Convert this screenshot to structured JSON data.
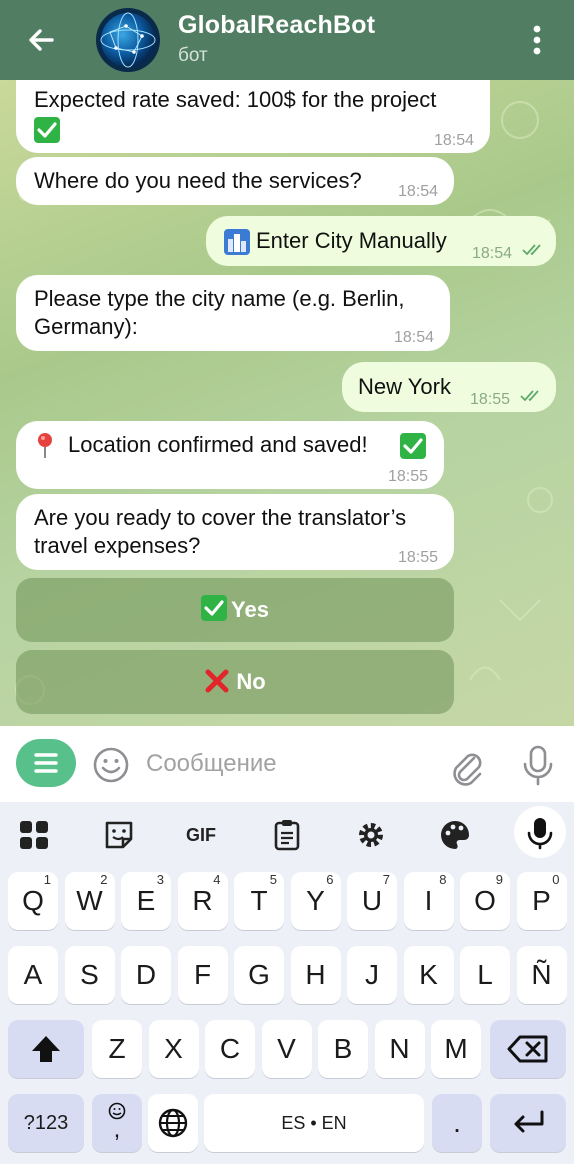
{
  "header": {
    "title": "GlobalReachBot",
    "subtitle": "бот"
  },
  "messages": [
    {
      "text": "Expected rate saved: 100$ for the project",
      "time": "18:54"
    },
    {
      "text": "Where do you need the services?",
      "time": "18:54"
    },
    {
      "text": "Enter City Manually",
      "time": "18:54"
    },
    {
      "line1": "Please type the city name (e.g. Berlin,",
      "line2": "Germany):",
      "time": "18:54"
    },
    {
      "text": "New York",
      "time": "18:55"
    },
    {
      "text": "Location confirmed and saved!",
      "time": "18:55"
    },
    {
      "line1": "Are you ready to cover the translator’s",
      "line2": "travel expenses?",
      "time": "18:55"
    }
  ],
  "buttons": {
    "yes": "Yes",
    "no": "No"
  },
  "composer": {
    "placeholder": "Сообщение"
  },
  "keyboard": {
    "toolbar": {
      "gif": "GIF"
    },
    "row1": [
      {
        "k": "Q",
        "s": "1"
      },
      {
        "k": "W",
        "s": "2"
      },
      {
        "k": "E",
        "s": "3"
      },
      {
        "k": "R",
        "s": "4"
      },
      {
        "k": "T",
        "s": "5"
      },
      {
        "k": "Y",
        "s": "6"
      },
      {
        "k": "U",
        "s": "7"
      },
      {
        "k": "I",
        "s": "8"
      },
      {
        "k": "O",
        "s": "9"
      },
      {
        "k": "P",
        "s": "0"
      }
    ],
    "row2": [
      "A",
      "S",
      "D",
      "F",
      "G",
      "H",
      "J",
      "K",
      "L",
      "Ñ"
    ],
    "row3": [
      "Z",
      "X",
      "C",
      "V",
      "B",
      "N",
      "M"
    ],
    "symbols": "?123",
    "space": "ES • EN",
    "period": ".",
    "emoji_comma": ","
  },
  "colors": {
    "header": "#517d63",
    "accent": "#58c08a",
    "tick": "#5ea86a"
  }
}
